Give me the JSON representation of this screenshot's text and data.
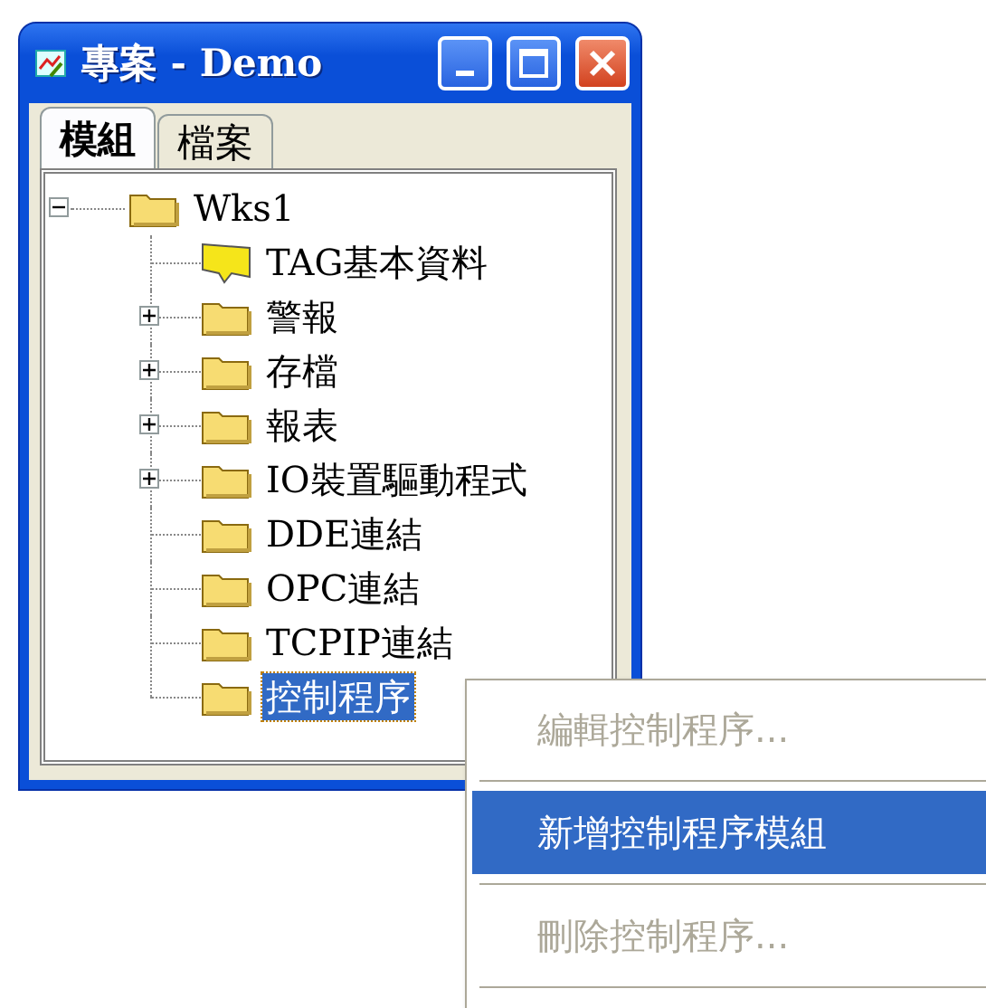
{
  "window": {
    "title": "專案 - Demo"
  },
  "tabs": [
    {
      "label": "模組",
      "selected": true
    },
    {
      "label": "檔案",
      "selected": false
    }
  ],
  "tree": {
    "label": "Wks1",
    "kind": "folder",
    "expanded": true,
    "children": [
      {
        "label": "TAG基本資料",
        "kind": "tag",
        "expandable": false,
        "selected": false
      },
      {
        "label": "警報",
        "kind": "folder",
        "expandable": true,
        "selected": false
      },
      {
        "label": "存檔",
        "kind": "folder",
        "expandable": true,
        "selected": false
      },
      {
        "label": "報表",
        "kind": "folder",
        "expandable": true,
        "selected": false
      },
      {
        "label": "IO裝置驅動程式",
        "kind": "folder",
        "expandable": true,
        "selected": false
      },
      {
        "label": "DDE連結",
        "kind": "folder",
        "expandable": false,
        "selected": false
      },
      {
        "label": "OPC連結",
        "kind": "folder",
        "expandable": false,
        "selected": false
      },
      {
        "label": "TCPIP連結",
        "kind": "folder",
        "expandable": false,
        "selected": false
      },
      {
        "label": "控制程序",
        "kind": "folder",
        "expandable": false,
        "selected": true
      }
    ]
  },
  "context_menu": [
    {
      "label": "編輯控制程序...",
      "disabled": true,
      "selected": false
    },
    {
      "label": "新增控制程序模組",
      "disabled": false,
      "selected": true
    },
    {
      "label": "刪除控制程序...",
      "disabled": true,
      "selected": false
    }
  ]
}
